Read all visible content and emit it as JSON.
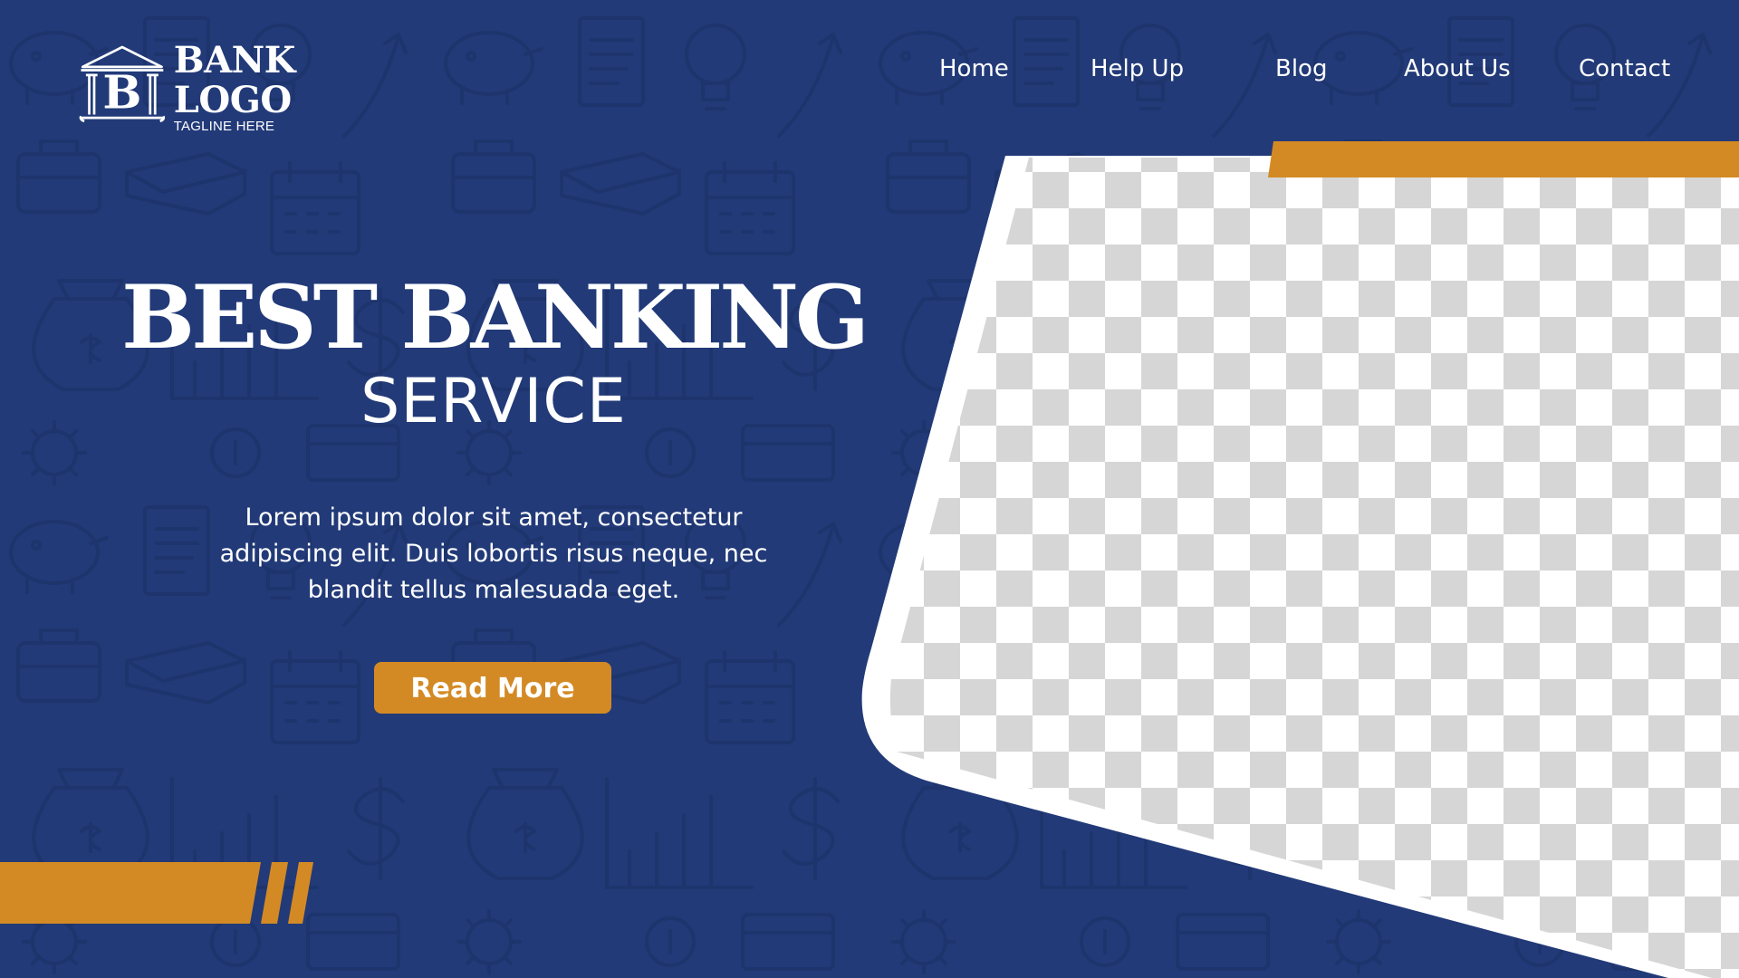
{
  "brand": {
    "monogram": "B",
    "name": "BANK LOGO",
    "tagline": "TAGLINE HERE"
  },
  "nav": {
    "items": [
      {
        "label": "Home"
      },
      {
        "label": "Help Up"
      },
      {
        "label": "Blog"
      },
      {
        "label": "About Us"
      },
      {
        "label": "Contact"
      }
    ]
  },
  "hero": {
    "title": "BEST BANKING",
    "subtitle": "SERVICE",
    "body_lines": [
      "Lorem ipsum dolor sit amet, consectetur",
      "adipiscing elit. Duis lobortis risus neque, nec",
      "blandit tellus malesuada eget."
    ],
    "cta_label": "Read More"
  },
  "image_placeholder": {
    "icon": "transparent-checkerboard"
  },
  "colors": {
    "background": "#223a78",
    "accent": "#d48a24",
    "text": "#ffffff",
    "pattern_line": "#15295a",
    "checker_light": "#ffffff",
    "checker_dark": "#d6d6d6"
  }
}
